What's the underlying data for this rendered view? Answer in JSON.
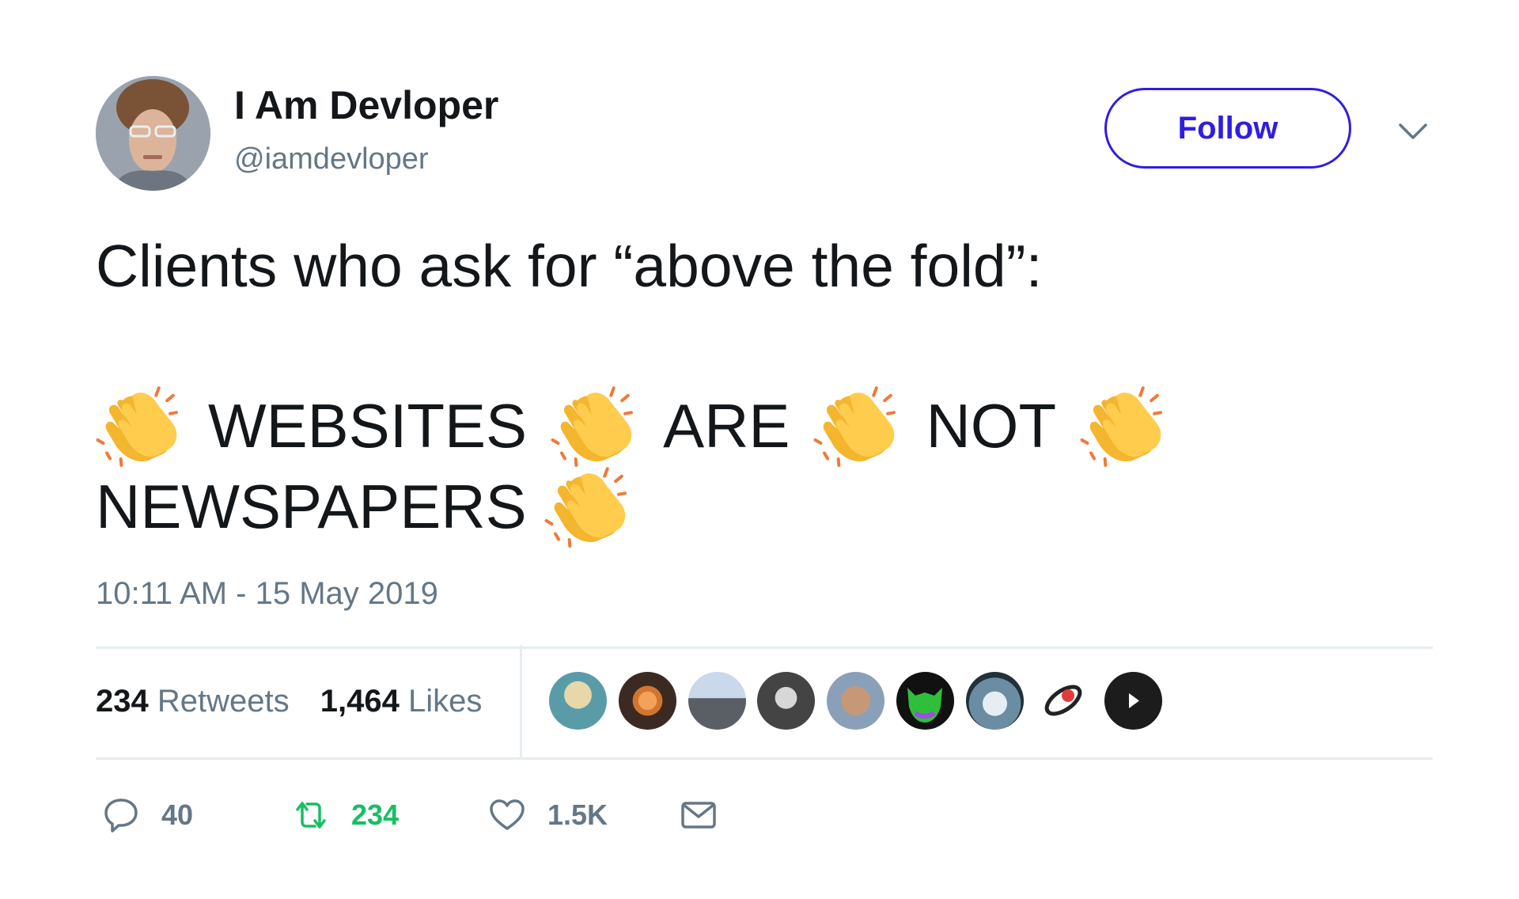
{
  "user": {
    "display_name": "I Am Devloper",
    "handle": "@iamdevloper"
  },
  "follow_button": {
    "label": "Follow"
  },
  "tweet": {
    "line1": "Clients who ask for “above the fold”:",
    "words": [
      "WEBSITES",
      "ARE",
      "NOT"
    ],
    "last_word": "NEWSPAPERS",
    "timestamp": "10:11 AM - 15 May 2019"
  },
  "stats": {
    "retweets_count": "234",
    "retweets_label": "Retweets",
    "likes_count": "1,464",
    "likes_label": "Likes"
  },
  "actions": {
    "reply_count": "40",
    "retweet_count": "234",
    "like_count": "1.5K"
  },
  "colors": {
    "follow_accent": "#2f1ee0",
    "secondary_text": "#657786",
    "retweet_green": "#17bf63",
    "divider": "#e6ecf0"
  },
  "icons": [
    "clapping-hands-icon",
    "chevron-down-icon",
    "reply-icon",
    "retweet-icon",
    "heart-icon",
    "mail-icon",
    "play-icon"
  ]
}
